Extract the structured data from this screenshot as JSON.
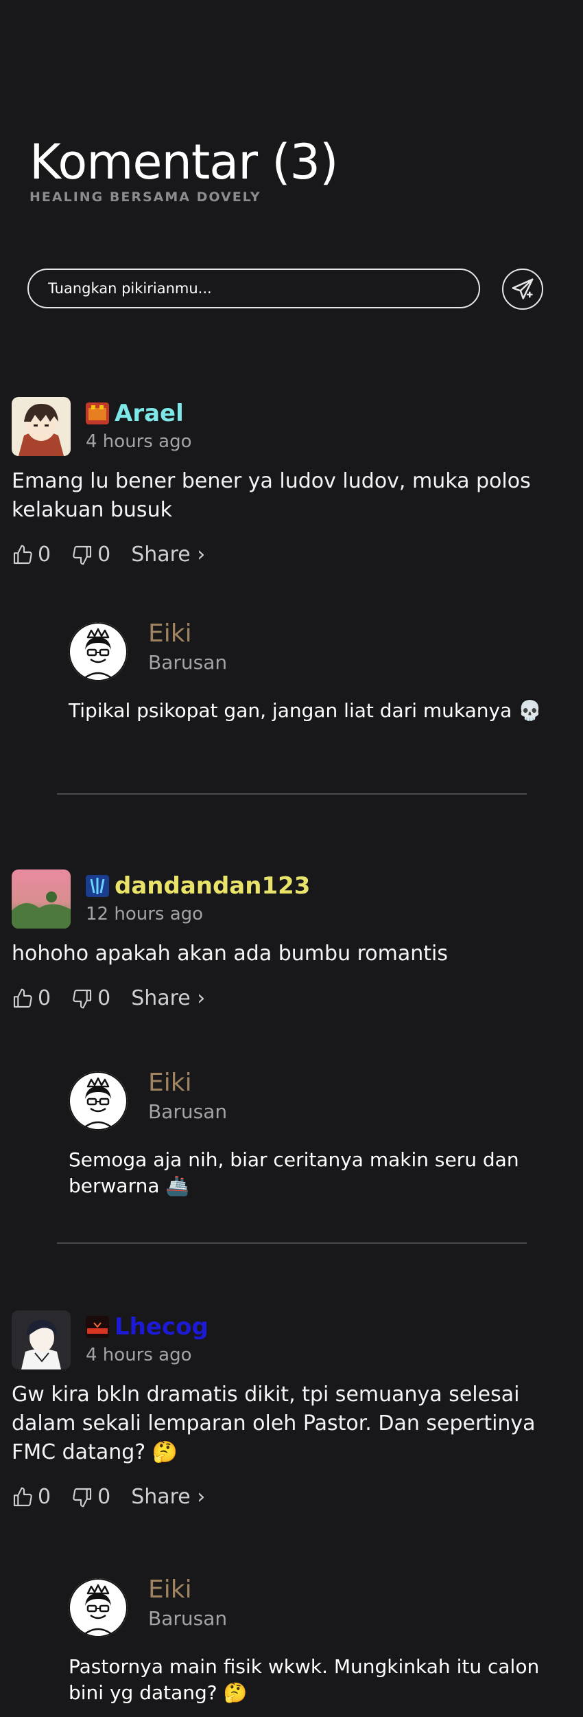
{
  "header": {
    "title": "Komentar (3)",
    "subtitle": "HEALING BERSAMA DOVELY"
  },
  "composer": {
    "placeholder": "Tuangkan pikirianmu...",
    "send_icon": "paper-plane-icon"
  },
  "comments": [
    {
      "author": "Arael",
      "author_color": "#7ee7e7",
      "time": "4 hours ago",
      "text": "Emang lu bener bener ya ludov ludov, muka polos kelakuan busuk",
      "likes": "0",
      "dislikes": "0",
      "share_label": "Share ›",
      "reply": {
        "author": "Eiki",
        "time": "Barusan",
        "text": "Tipikal psikopat gan, jangan liat dari mukanya 💀"
      }
    },
    {
      "author": "dandandan123",
      "author_color": "#e9e36a",
      "time": "12 hours ago",
      "text": "hohoho apakah akan ada bumbu romantis",
      "likes": "0",
      "dislikes": "0",
      "share_label": "Share ›",
      "reply": {
        "author": "Eiki",
        "time": "Barusan",
        "text": "Semoga aja nih, biar ceritanya makin seru dan berwarna 🚢"
      }
    },
    {
      "author": "Lhecog",
      "author_color": "#1d1ad6",
      "time": "4 hours ago",
      "text": "Gw kira bkln dramatis dikit, tpi semuanya selesai dalam sekali lemparan oleh Pastor. Dan sepertinya FMC datang? 🤔",
      "likes": "0",
      "dislikes": "0",
      "share_label": "Share ›",
      "reply": {
        "author": "Eiki",
        "time": "Barusan",
        "text": "Pastornya main fisik wkwk. Mungkinkah itu calon bini yg datang? 🤔"
      }
    }
  ]
}
